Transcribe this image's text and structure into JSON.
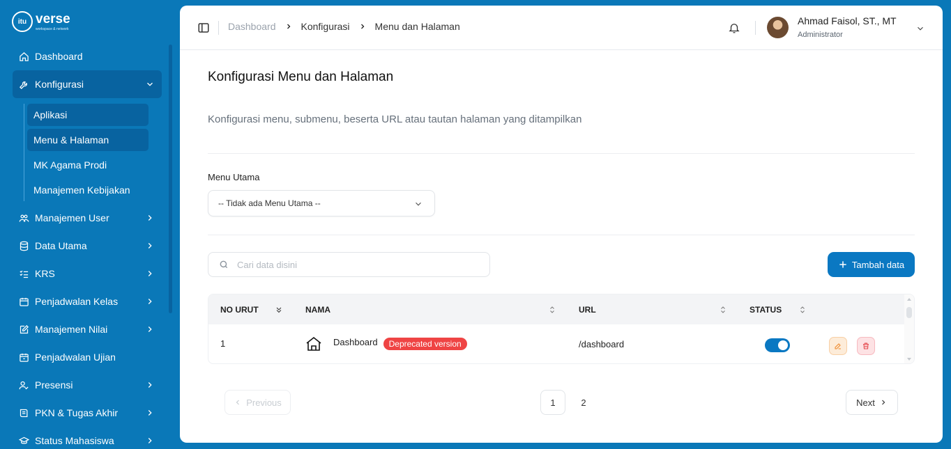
{
  "app": {
    "logo_text": "verse",
    "logo_tagline": "workspace & network",
    "logo_mark": "itu"
  },
  "sidebar": {
    "items": [
      {
        "label": "Dashboard",
        "icon": "home-icon"
      },
      {
        "label": "Konfigurasi",
        "icon": "wrench-icon",
        "expanded": true
      },
      {
        "label": "Manajemen User",
        "icon": "users-icon"
      },
      {
        "label": "Data Utama",
        "icon": "database-icon"
      },
      {
        "label": "KRS",
        "icon": "list-check-icon"
      },
      {
        "label": "Penjadwalan Kelas",
        "icon": "calendar-icon"
      },
      {
        "label": "Manajemen Nilai",
        "icon": "edit-icon"
      },
      {
        "label": "Penjadwalan Ujian",
        "icon": "calendar-icon"
      },
      {
        "label": "Presensi",
        "icon": "user-check-icon"
      },
      {
        "label": "PKN & Tugas Akhir",
        "icon": "book-icon"
      },
      {
        "label": "Status Mahasiswa",
        "icon": "graduation-icon"
      }
    ],
    "sub_items": [
      {
        "label": "Aplikasi"
      },
      {
        "label": "Menu & Halaman"
      },
      {
        "label": "MK Agama Prodi"
      },
      {
        "label": "Manajemen Kebijakan"
      }
    ]
  },
  "header": {
    "breadcrumb": [
      "Dashboard",
      "Konfigurasi",
      "Menu dan Halaman"
    ],
    "user_name": "Ahmad Faisol, ST., MT",
    "user_role": "Administrator"
  },
  "page": {
    "title": "Konfigurasi Menu dan Halaman",
    "description": "Konfigurasi menu, submenu, beserta URL atau tautan halaman yang ditampilkan",
    "menu_label": "Menu Utama",
    "menu_selected": "-- Tidak ada Menu Utama --",
    "search_placeholder": "Cari data disini",
    "add_button": "Tambah data"
  },
  "table": {
    "columns": [
      "NO URUT",
      "NAMA",
      "URL",
      "STATUS"
    ],
    "rows": [
      {
        "no": "1",
        "icon": "home-icon",
        "name": "Dashboard",
        "badge": "Deprecated version",
        "url": "/dashboard",
        "status": true
      }
    ]
  },
  "pagination": {
    "previous": "Previous",
    "next": "Next",
    "pages": [
      "1",
      "2"
    ],
    "current": "1"
  },
  "colors": {
    "brand": "#0a78b8",
    "primary": "#0a78c2",
    "danger": "#ef4444"
  }
}
